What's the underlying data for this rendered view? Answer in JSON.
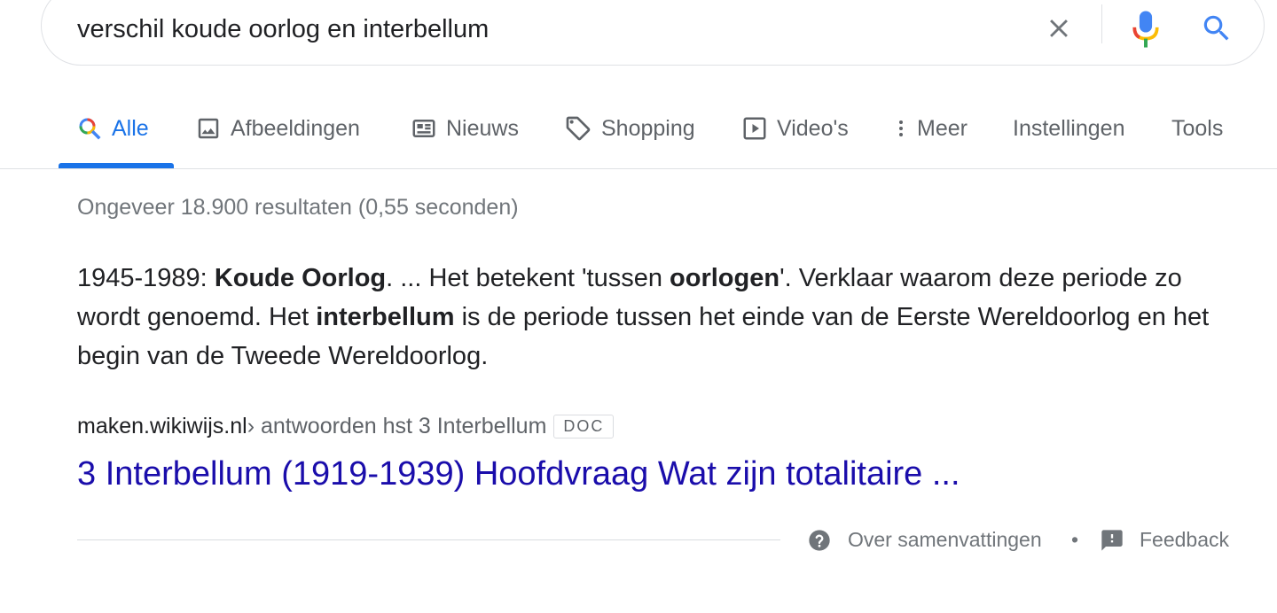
{
  "search": {
    "query": "verschil koude oorlog en interbellum"
  },
  "tabs": [
    {
      "label": "Alle",
      "icon": "search-icon",
      "active": true
    },
    {
      "label": "Afbeeldingen",
      "icon": "image-icon"
    },
    {
      "label": "Nieuws",
      "icon": "news-icon"
    },
    {
      "label": "Shopping",
      "icon": "tag-icon"
    },
    {
      "label": "Video's",
      "icon": "play-icon"
    },
    {
      "label": "Meer",
      "icon": "more-vert-icon"
    }
  ],
  "tools": {
    "settings_label": "Instellingen",
    "tools_label": "Tools"
  },
  "stats": "Ongeveer 18.900 resultaten (0,55 seconden)",
  "snippet": {
    "parts": [
      {
        "t": "1945-1989: ",
        "b": false
      },
      {
        "t": "Koude Oorlog",
        "b": true
      },
      {
        "t": ". ... Het betekent 'tussen ",
        "b": false
      },
      {
        "t": "oorlogen",
        "b": true
      },
      {
        "t": "'. Verklaar waarom deze periode zo wordt genoemd. Het ",
        "b": false
      },
      {
        "t": "interbellum",
        "b": true
      },
      {
        "t": " is de periode tussen het einde van de Eerste Wereldoorlog en het begin van de Tweede Wereldoorlog.",
        "b": false
      }
    ]
  },
  "result": {
    "domain": "maken.wikiwijs.nl",
    "breadcrumb": " › antwoorden hst 3 Interbellum",
    "badge": "DOC",
    "title": "3 Interbellum (1919-1939) Hoofdvraag Wat zijn totalitaire ..."
  },
  "footer": {
    "about_label": "Over samenvattingen",
    "separator": "•",
    "feedback_label": "Feedback"
  },
  "colors": {
    "accent": "#1a73e8",
    "link": "#1a0dab",
    "muted": "#70757a"
  }
}
